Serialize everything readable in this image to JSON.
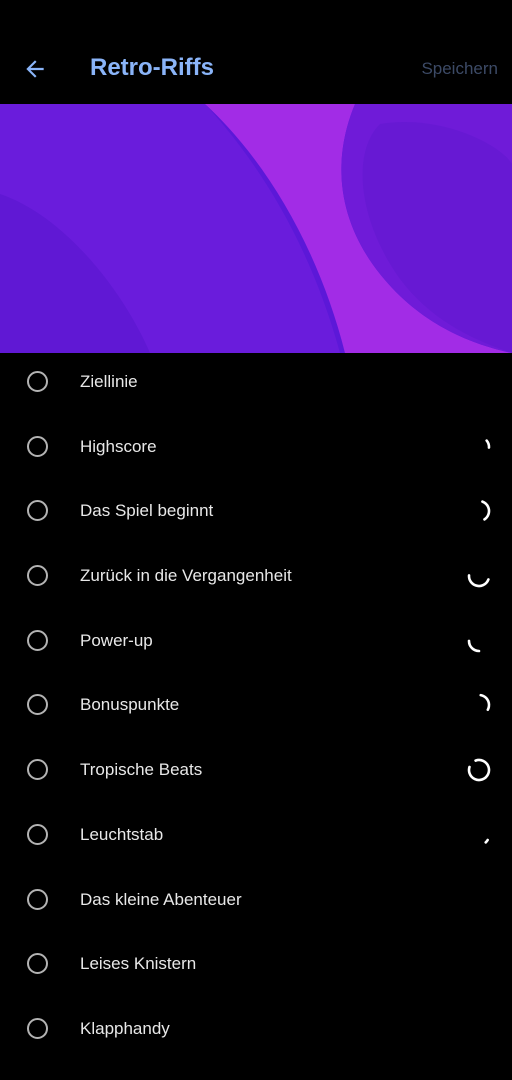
{
  "header": {
    "back_icon": "arrow-left-icon",
    "title": "Retro-Riffs",
    "save_label": "Speichern"
  },
  "banner": {
    "colors": [
      "#5a18d6",
      "#7a1fe2",
      "#a22ce4",
      "#6b19d6"
    ]
  },
  "sounds": [
    {
      "label": "Ziellinie",
      "selected": false,
      "loading": false
    },
    {
      "label": "Highscore",
      "selected": false,
      "loading": true
    },
    {
      "label": "Das Spiel beginnt",
      "selected": false,
      "loading": true
    },
    {
      "label": "Zurück in die Vergangenheit",
      "selected": false,
      "loading": true
    },
    {
      "label": "Power-up",
      "selected": false,
      "loading": true
    },
    {
      "label": "Bonuspunkte",
      "selected": false,
      "loading": true
    },
    {
      "label": "Tropische Beats",
      "selected": false,
      "loading": true
    },
    {
      "label": "Leuchtstab",
      "selected": false,
      "loading": true
    },
    {
      "label": "Das kleine Abenteuer",
      "selected": false,
      "loading": false
    },
    {
      "label": "Leises Knistern",
      "selected": false,
      "loading": false
    },
    {
      "label": "Klapphandy",
      "selected": false,
      "loading": false
    }
  ],
  "accent_color": "#8ab4f8"
}
